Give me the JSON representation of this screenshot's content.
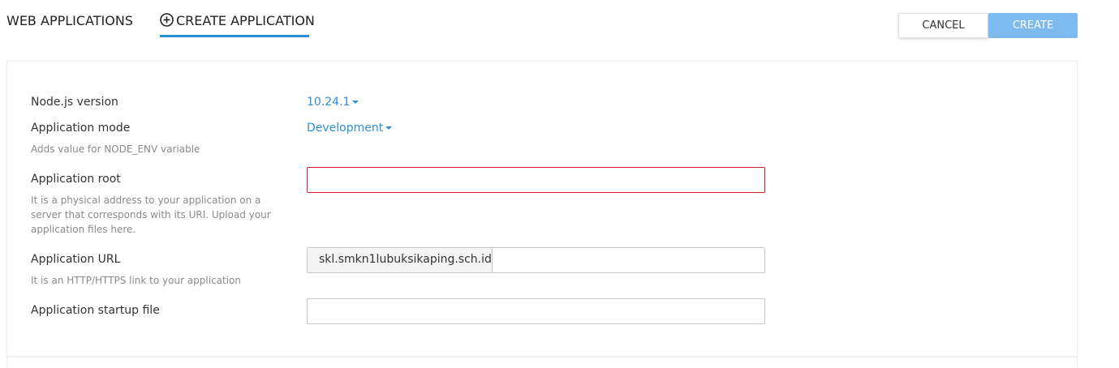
{
  "tabs": {
    "web_applications": "WEB APPLICATIONS",
    "create_application": "CREATE APPLICATION"
  },
  "buttons": {
    "cancel": "CANCEL",
    "create": "CREATE"
  },
  "form": {
    "nodejs_version": {
      "label": "Node.js version",
      "value": "10.24.1"
    },
    "application_mode": {
      "label": "Application mode",
      "value": "Development",
      "hint": "Adds value for NODE_ENV variable"
    },
    "application_root": {
      "label": "Application root",
      "value": "",
      "hint": "It is a physical address to your application on a server that corresponds with its URI. Upload your application files here."
    },
    "application_url": {
      "label": "Application URL",
      "domain": "skl.smkn1lubuksikaping.sch.id",
      "value": "",
      "hint": "It is an HTTP/HTTPS link to your application"
    },
    "application_startup_file": {
      "label": "Application startup file",
      "value": ""
    }
  },
  "colors": {
    "accent": "#2f8fd8",
    "create_button": "#7cbaf0",
    "error_border": "#d0212a"
  },
  "icons": {
    "create_tab": "plus-circle-icon",
    "dropdown": "caret-down-icon"
  }
}
